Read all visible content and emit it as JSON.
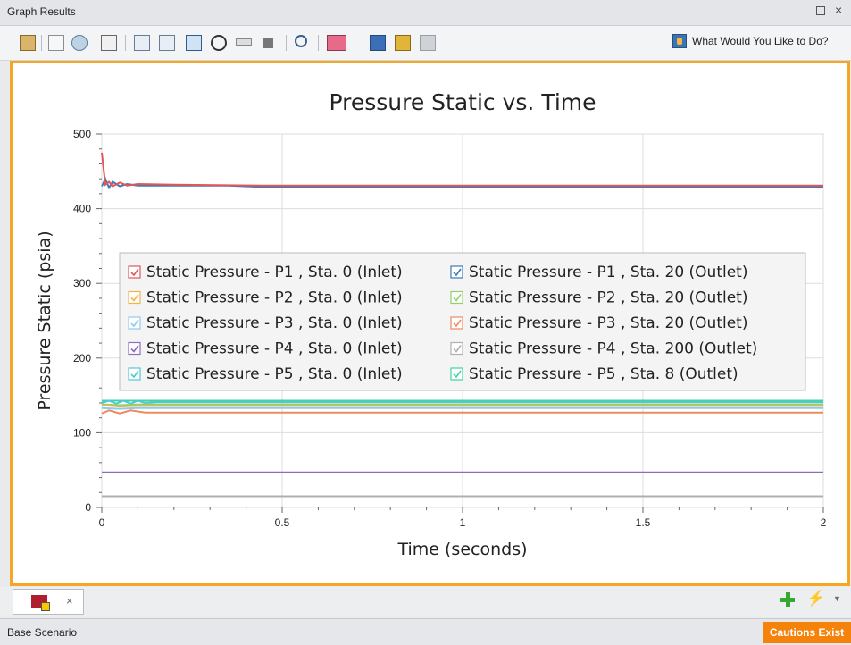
{
  "window": {
    "title": "Graph Results"
  },
  "toolbar": {
    "help_label": "What Would You Like to Do?"
  },
  "chart_data": {
    "type": "line",
    "title": "Pressure Static vs. Time",
    "xlabel": "Time (seconds)",
    "ylabel": "Pressure Static (psia)",
    "xlim": [
      0,
      2
    ],
    "ylim": [
      0,
      500
    ],
    "x_ticks": [
      "0",
      "0.5",
      "1",
      "1.5",
      "2"
    ],
    "y_ticks": [
      "0",
      "100",
      "200",
      "300",
      "400",
      "500"
    ],
    "grid": true,
    "legend_placement": "center-left",
    "series": [
      {
        "name": "Static Pressure - P1 , Sta. 0 (Inlet)",
        "color": "#e15759",
        "x": [
          0,
          0.01,
          0.02,
          0.03,
          0.05,
          0.07,
          0.1,
          0.2,
          0.45,
          2
        ],
        "y": [
          475,
          432,
          436,
          430,
          435,
          431,
          433,
          432,
          431,
          431
        ]
      },
      {
        "name": "Static Pressure - P1 , Sta. 20 (Outlet)",
        "color": "#3d7ab8",
        "x": [
          0,
          0.01,
          0.02,
          0.03,
          0.05,
          0.07,
          0.1,
          0.35,
          0.45,
          2
        ],
        "y": [
          430,
          440,
          428,
          436,
          430,
          433,
          431,
          431,
          429,
          429
        ]
      },
      {
        "name": "Static Pressure - P2 , Sta. 0 (Inlet)",
        "color": "#f2b447",
        "x": [
          0,
          0.05,
          0.1,
          2
        ],
        "y": [
          137,
          135,
          136,
          136
        ]
      },
      {
        "name": "Static Pressure - P2 , Sta. 20 (Outlet)",
        "color": "#8fd16a",
        "x": [
          0,
          0.05,
          0.1,
          2
        ],
        "y": [
          138,
          137,
          138,
          138
        ]
      },
      {
        "name": "Static Pressure - P3 , Sta. 0 (Inlet)",
        "color": "#8ccbf0",
        "x": [
          0,
          0.05,
          0.1,
          2
        ],
        "y": [
          133,
          132,
          133,
          133
        ]
      },
      {
        "name": "Static Pressure - P3 , Sta. 20 (Outlet)",
        "color": "#f08a5d",
        "x": [
          0,
          0.02,
          0.05,
          0.08,
          0.12,
          2
        ],
        "y": [
          126,
          130,
          126,
          130,
          127,
          127
        ]
      },
      {
        "name": "Static Pressure - P4 , Sta. 0 (Inlet)",
        "color": "#8e6bbf",
        "x": [
          0,
          2
        ],
        "y": [
          47,
          47
        ]
      },
      {
        "name": "Static Pressure - P4 , Sta. 200 (Outlet)",
        "color": "#b0b0b0",
        "x": [
          0,
          2
        ],
        "y": [
          15,
          15
        ]
      },
      {
        "name": "Static Pressure - P5 , Sta. 0 (Inlet)",
        "color": "#4fc8d8",
        "x": [
          0,
          0.02,
          0.04,
          0.06,
          0.08,
          0.1,
          0.12,
          0.15,
          2
        ],
        "y": [
          140,
          143,
          139,
          143,
          139,
          143,
          140,
          141,
          141
        ]
      },
      {
        "name": "Static Pressure - P5 , Sta. 8 (Outlet)",
        "color": "#3fd6a3",
        "x": [
          0,
          2
        ],
        "y": [
          143,
          143
        ]
      }
    ]
  },
  "tabs": [
    {
      "label": "×"
    }
  ],
  "status": {
    "scenario": "Base Scenario",
    "cautions": "Cautions Exist"
  }
}
